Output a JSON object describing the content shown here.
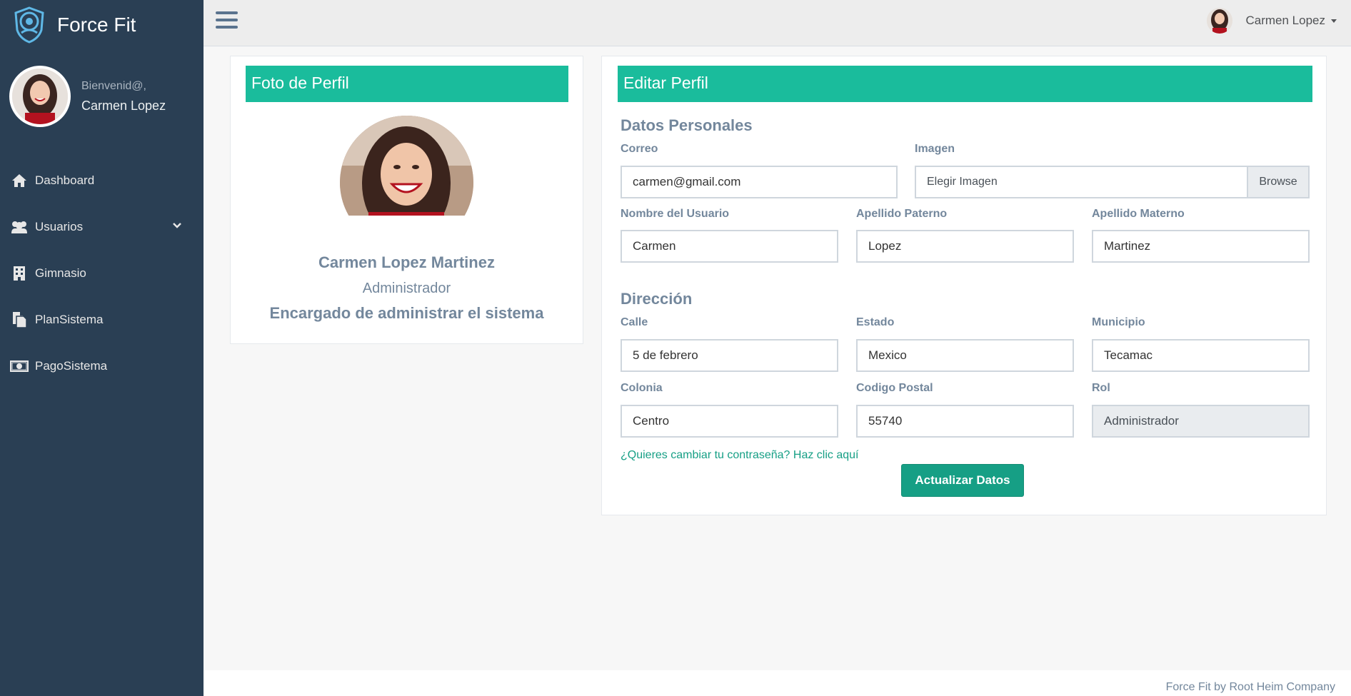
{
  "app": {
    "title": "Force Fit"
  },
  "sidebar": {
    "welcome": "Bienvenid@,",
    "user_name": "Carmen Lopez",
    "items": [
      {
        "label": "Dashboard",
        "icon": "home-icon"
      },
      {
        "label": "Usuarios",
        "icon": "users-icon"
      },
      {
        "label": "Gimnasio",
        "icon": "building-icon"
      },
      {
        "label": "PlanSistema",
        "icon": "files-icon"
      },
      {
        "label": "PagoSistema",
        "icon": "money-icon"
      }
    ]
  },
  "topnav": {
    "user_name": "Carmen Lopez"
  },
  "photo_panel": {
    "header": "Foto de Perfil",
    "full_name": "Carmen Lopez Martinez",
    "role": "Administrador",
    "description": "Encargado de administrar el sistema"
  },
  "edit_panel": {
    "header": "Editar Perfil",
    "personal_title": "Datos Personales",
    "address_title": "Dirección",
    "fields": {
      "correo": {
        "label": "Correo",
        "value": "carmen@gmail.com"
      },
      "imagen": {
        "label": "Imagen",
        "placeholder": "Elegir Imagen",
        "button": "Browse"
      },
      "nombre": {
        "label": "Nombre del Usuario",
        "value": "Carmen"
      },
      "apellido_paterno": {
        "label": "Apellido Paterno",
        "value": "Lopez"
      },
      "apellido_materno": {
        "label": "Apellido Materno",
        "value": "Martinez"
      },
      "calle": {
        "label": "Calle",
        "value": "5 de febrero"
      },
      "estado": {
        "label": "Estado",
        "value": "Mexico"
      },
      "municipio": {
        "label": "Municipio",
        "value": "Tecamac"
      },
      "colonia": {
        "label": "Colonia",
        "value": "Centro"
      },
      "codigo_postal": {
        "label": "Codigo Postal",
        "value": "55740"
      },
      "rol": {
        "label": "Rol",
        "value": "Administrador"
      }
    },
    "password_link": "¿Quieres cambiar tu contraseña? Haz clic aquí",
    "submit": "Actualizar Datos"
  },
  "footer": {
    "text": "Force Fit by Root Heim Company"
  },
  "colors": {
    "sidebar": "#2a3f54",
    "accent": "#1abc9c",
    "button": "#169f85"
  }
}
